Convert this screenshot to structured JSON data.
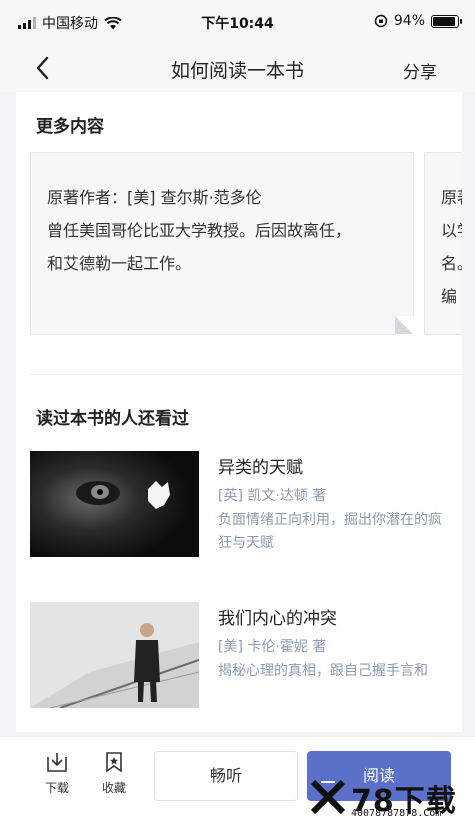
{
  "status_bar": {
    "carrier": "中国移动",
    "time": "下午10:44",
    "battery": "94%"
  },
  "navbar": {
    "title": "如何阅读一本书",
    "share_label": "分享"
  },
  "more_content": {
    "title": "更多内容",
    "cards": [
      {
        "lines": [
          "原著作者：[美] 查尔斯·范多伦",
          "曾任美国哥伦比亚大学教授。后因故离任，",
          "和艾德勒一起工作。"
        ]
      },
      {
        "lines": [
          "原著",
          "以学",
          "名。",
          "编"
        ]
      }
    ]
  },
  "also_read": {
    "title": "读过本书的人还看过",
    "books": [
      {
        "name": "异类的天赋",
        "author": "[英] 凯文·达顿 著",
        "desc": "负面情绪正向利用，掘出你潜在的疯狂与天赋"
      },
      {
        "name": "我们内心的冲突",
        "author": "[美] 卡伦·霍妮 著",
        "desc": "揭秘心理的真相，跟自己握手言和"
      }
    ]
  },
  "bottom_bar": {
    "download_label": "下载",
    "favorite_label": "收藏",
    "listen_label": "畅听",
    "read_label": "阅读"
  },
  "watermark": {
    "text": "78下载",
    "url": "40078787878.Com"
  },
  "colors": {
    "accent": "#5b71c9",
    "meta_text": "#8d9bb3"
  }
}
